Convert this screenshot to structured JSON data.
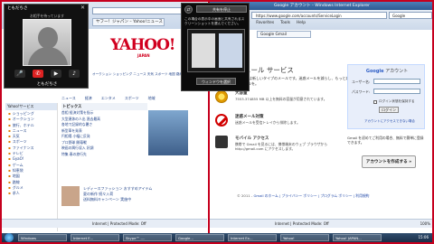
{
  "taskbar": {
    "items": [
      "Windows",
      "Internet E...",
      "Skype™ -...",
      "Google...",
      "Internet Ex...",
      "Yahoo!",
      "Yahoo! JAPAN..."
    ],
    "clock": "15:06"
  },
  "left_browser": {
    "tab": "ヤフー！ジャパン – Yahoo!ニュース",
    "yahoo_logo": "YAHOO!",
    "yahoo_sub": "JAPAN",
    "nav": "オークション  ショッピング  ニュース  天気  スポーツ  地図  路線",
    "tabs": [
      "ニュース",
      "経済",
      "エンタメ",
      "スポーツ",
      "地域"
    ],
    "side_header": "Yahoo!サービス",
    "side_items": [
      "ショッピング",
      "オークション",
      "旅行、ホテル",
      "ニュース",
      "天気",
      "スポーツ",
      "ファイナンス",
      "テレビ",
      "GyaO!",
      "ゲーム",
      "知恵袋",
      "地図",
      "路線",
      "グルメ",
      "求人"
    ],
    "topics_header": "トピックス",
    "topics": [
      "首相 経済対策を指示",
      "大型連休の人出 過去最高",
      "各地で記録的な暑さ",
      "新型車を発表",
      "円相場 小幅に反発",
      "プロ野球 開幕戦",
      "映画の興行収入 好調",
      "特集 春の旅行先"
    ],
    "ad": [
      "レディースファッション おすすめアイテム",
      "夏の新作 続々入荷",
      "送料無料キャンペーン 実施中"
    ],
    "status": "Internet | Protected Mode: Off"
  },
  "right_browser": {
    "title": "Google アカウント - Windows Internet Explorer",
    "address": "https://www.google.com/accounts/ServiceLogin",
    "search": "Google",
    "menu": [
      "File",
      "Edit",
      "View",
      "Favorites",
      "Tools",
      "Help"
    ],
    "tab": "Google Gmail",
    "heading": "メール サービス",
    "intro": "Gmail は新しいタイプのメールです。迷惑メールを減らし、もっと楽しいメールを。",
    "features": [
      {
        "icon": "clock-icon",
        "title": "大容量",
        "desc": "7553.374855 MB 以上を無料の容量が用意されています。"
      },
      {
        "icon": "no-spam-icon",
        "title": "迷惑メール対策",
        "desc": "迷惑メールを受信トレイから排除します。"
      },
      {
        "icon": "phone-icon",
        "title": "モバイル アクセス",
        "desc": "携帯で Gmail を見るには、携帯端末のウェブ ブラウザから http://gmail.com にアクセスします。"
      }
    ],
    "footer": [
      "© 2011 - ",
      "Gmail のホーム",
      "プライバシー ポリシー",
      "プログラム ポリシー",
      "利用規約"
    ],
    "login": {
      "brand": "Google",
      "title": " アカウント",
      "user_label": "ユーザー名:",
      "pass_label": "パスワード:",
      "remember": "ログイン状態を保持する",
      "button": "ログイン",
      "help": "アカウントにアクセスできない場合"
    },
    "signup_text": "Gmail を初めてご利用の場合、無料で簡単に登録できます。",
    "signup_button": "アカウントを作成する »",
    "status": "Internet | Protected Mode: Off",
    "zoom": "100%"
  },
  "video_call": {
    "title": "ともだちさ",
    "name_top": "お相手を待っています",
    "name": "ともだちさ",
    "buttons": [
      "mic-icon",
      "end-call-icon",
      "video-icon",
      "speaker-icon"
    ]
  },
  "popup": {
    "button_top": "共有を停止",
    "text": "この場合の表示中の画面と共有されるスクリーンショットを選んでください。",
    "button_bottom": "ウィンドウを選択"
  }
}
